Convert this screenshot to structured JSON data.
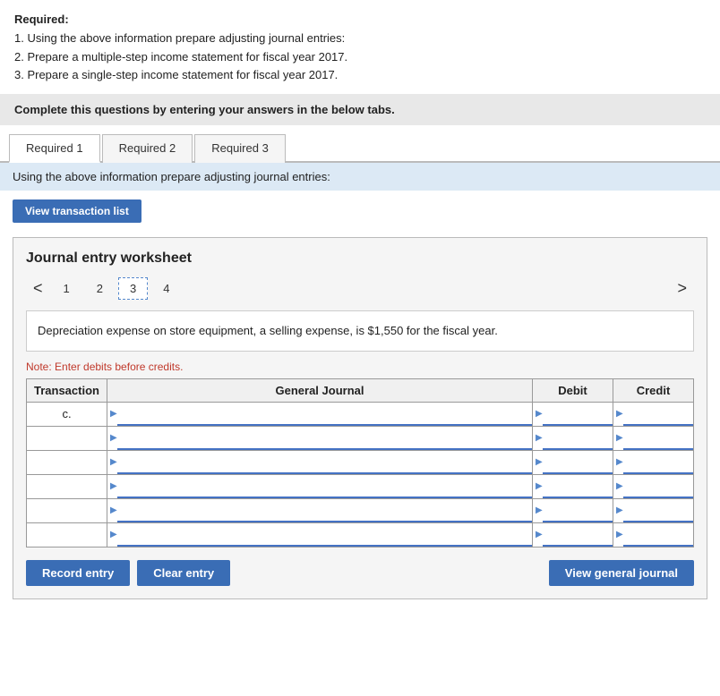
{
  "instructions": {
    "required_label": "Required:",
    "step1": "1. Using the above information prepare adjusting journal entries:",
    "step2": "2. Prepare a multiple-step income statement for fiscal year 2017.",
    "step3": "3. Prepare a single-step income statement for fiscal year 2017."
  },
  "banner": {
    "text": "Complete this questions by entering your answers in the below tabs."
  },
  "tabs": [
    {
      "label": "Required 1",
      "active": true
    },
    {
      "label": "Required 2",
      "active": false
    },
    {
      "label": "Required 3",
      "active": false
    }
  ],
  "tab_description": "Using the above information prepare adjusting journal entries:",
  "view_transaction_btn": "View transaction list",
  "worksheet": {
    "title": "Journal entry worksheet",
    "pages": [
      "1",
      "2",
      "3",
      "4"
    ],
    "active_page": "3",
    "prev_arrow": "<",
    "next_arrow": ">",
    "description": "Depreciation expense on store equipment, a selling expense, is $1,550 for the fiscal year.",
    "note": "Note: Enter debits before credits.",
    "table": {
      "headers": [
        "Transaction",
        "General Journal",
        "Debit",
        "Credit"
      ],
      "rows": [
        {
          "transaction": "c.",
          "journal": "",
          "debit": "",
          "credit": ""
        },
        {
          "transaction": "",
          "journal": "",
          "debit": "",
          "credit": ""
        },
        {
          "transaction": "",
          "journal": "",
          "debit": "",
          "credit": ""
        },
        {
          "transaction": "",
          "journal": "",
          "debit": "",
          "credit": ""
        },
        {
          "transaction": "",
          "journal": "",
          "debit": "",
          "credit": ""
        },
        {
          "transaction": "",
          "journal": "",
          "debit": "",
          "credit": ""
        }
      ]
    }
  },
  "buttons": {
    "record_entry": "Record entry",
    "clear_entry": "Clear entry",
    "view_general_journal": "View general journal"
  }
}
